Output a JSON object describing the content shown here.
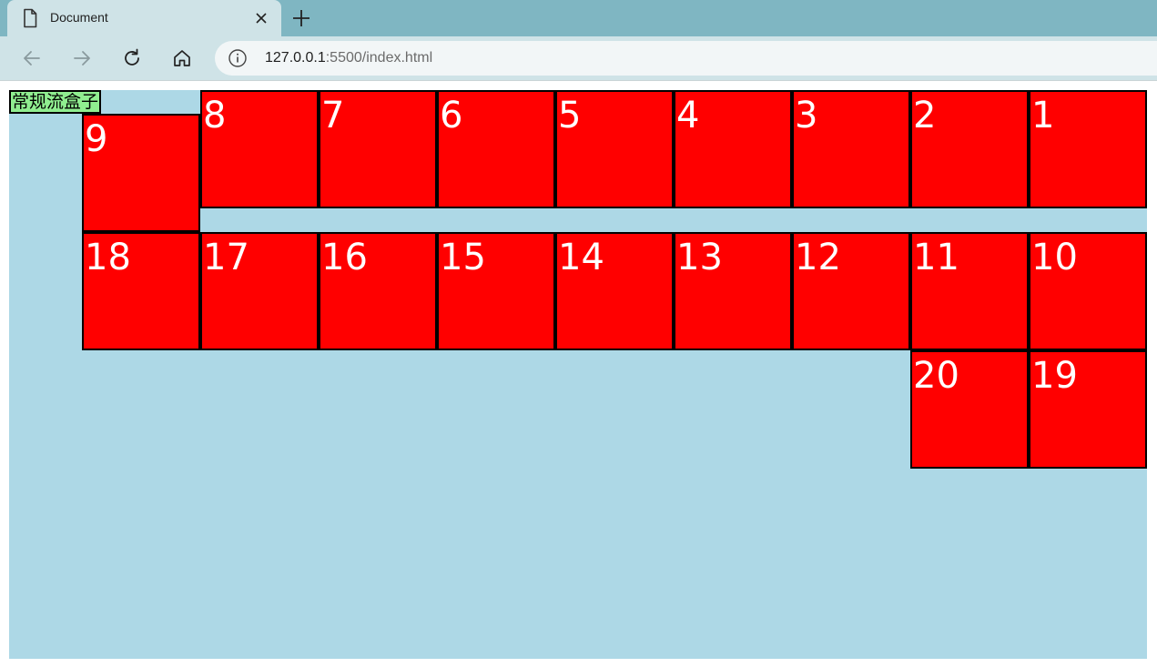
{
  "browser": {
    "tab_title": "Document",
    "url_host": "127.0.0.1",
    "url_rest": ":5500/index.html"
  },
  "page": {
    "normal_box_label": "常规流盒子",
    "boxes": [
      "1",
      "2",
      "3",
      "4",
      "5",
      "6",
      "7",
      "8",
      "9",
      "10",
      "11",
      "12",
      "13",
      "14",
      "15",
      "16",
      "17",
      "18",
      "19",
      "20"
    ]
  },
  "colors": {
    "container": "#add8e6",
    "box": "#ff0000",
    "normal_box": "#90ee90"
  },
  "icons": [
    "document-icon",
    "close-icon",
    "plus-icon",
    "back-icon",
    "forward-icon",
    "reload-icon",
    "home-icon",
    "info-icon"
  ]
}
